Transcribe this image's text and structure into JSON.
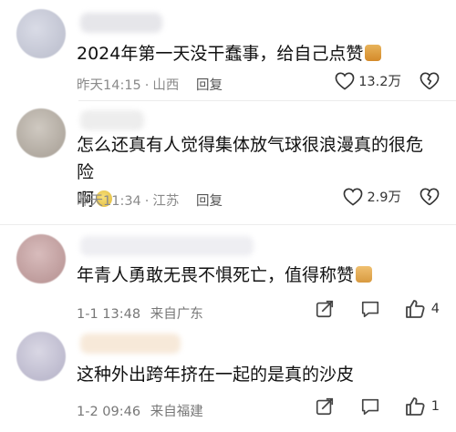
{
  "comments": [
    {
      "text": "2024年第一天没干蠢事，给自己点赞",
      "time": "昨天14:15",
      "location": "山西",
      "reply": "回复",
      "likes": "13.2万",
      "style": "weibo",
      "avatar_color": "#c8cad6"
    },
    {
      "text_line1": "怎么还真有人觉得集体放气球很浪漫真的很危险",
      "text_line2": "啊",
      "time": "昨天11:34",
      "location": "江苏",
      "reply": "回复",
      "likes": "2.9万",
      "style": "weibo",
      "avatar_color": "#b8b1a8"
    },
    {
      "text": "年青人勇敢无畏不惧死亡，值得称赞",
      "date": "1-1 13:48",
      "location": "来自广东",
      "likes": "4",
      "style": "toutiao",
      "avatar_color": "#c9a9a9"
    },
    {
      "text": "这种外出跨年挤在一起的是真的沙皮",
      "date": "1-2 09:46",
      "location": "来自福建",
      "likes": "1",
      "style": "toutiao",
      "avatar_color": "#c6c4d2"
    }
  ],
  "icons": {
    "like": "heart-outline-icon",
    "dislike": "broken-heart-icon",
    "share": "share-icon",
    "comment": "comment-icon",
    "thumbs_up": "thumbs-up-icon",
    "emoji_cat": "cat-emoji-icon",
    "emoji_face": "sad-face-emoji-icon",
    "emoji_thumb": "thumbs-up-emoji-icon"
  }
}
